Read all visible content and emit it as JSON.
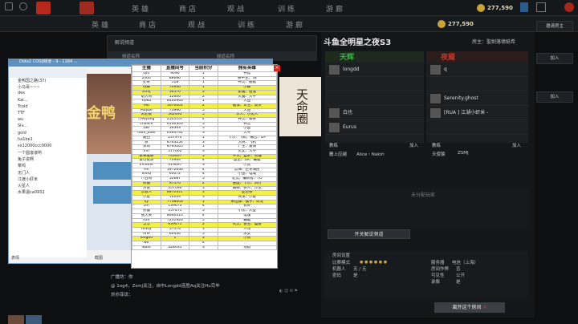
{
  "nav": {
    "items": [
      "英雄",
      "商店",
      "观战",
      "训练",
      "游廊"
    ]
  },
  "hud": {
    "gold": "277,590",
    "badge": "0"
  },
  "lobby": {
    "title": "解说频道",
    "col1": "频道名称",
    "col2": "频道名称"
  },
  "qq": {
    "title": "Dota2 COSIJ频道 - 9 - 1184 ...",
    "list": [
      "金鸭国之路(37)",
      "小马哥~~~",
      "dex",
      "Kai...",
      "Tcold",
      "TTF",
      "wu",
      "Slv...",
      "gold",
      "ha1be1",
      "sx12000ccc0000",
      "一个圆滚滚哟",
      "兔子说啊",
      "菜鸡",
      "无门人",
      "江渡小虾米",
      "火星人",
      "水果温ca0932"
    ],
    "chat_btns": [
      "表情",
      "截图",
      "发送"
    ]
  },
  "sheet": {
    "headers": [
      "主播",
      "直播间号",
      "当前积分",
      "拥有英雄"
    ],
    "rows": [
      [
        "zy0",
        "9090",
        "1",
        "神官"
      ],
      [
        "zhou",
        "88666",
        "1",
        "铁甲王、TB"
      ],
      [
        "老哥",
        "118",
        "1",
        "神灵、骷髅"
      ],
      [
        "谷辰",
        "74940",
        "1",
        "小娜"
      ],
      [
        "zsmj",
        "56570",
        "3",
        "影魔、石鬼"
      ],
      [
        "斩大哥",
        "12600",
        "2",
        "火猫、大牛"
      ],
      [
        "Haku",
        "8440963",
        "1",
        "大鱼"
      ],
      [
        "Mu",
        "1670001",
        "2",
        "敌法、斧王、双头"
      ],
      [
        "Maybe",
        "73966",
        "5",
        "大鱼"
      ],
      [
        "刘老板",
        "562493",
        "5",
        "水人、小黑人"
      ],
      [
        "小鸭yang",
        "2505147",
        "4",
        "神灵、钢背"
      ],
      [
        "chalice",
        "6130303",
        "5",
        "神灵"
      ],
      [
        "tab",
        "56363",
        "5",
        "小鱼"
      ],
      [
        "faith_bian",
        "6394791",
        "3",
        "大牛"
      ],
      [
        "路西",
        "237974",
        "1",
        "卡尔、飞机、痛苦、DP"
      ],
      [
        "依",
        "8763254",
        "3",
        "大树、飞机"
      ],
      [
        "深圳",
        "8763265",
        "1",
        "尸王、雷骑"
      ],
      [
        "lnh",
        "577002",
        "3",
        "火女、大牛"
      ],
      [
        "象咪猴聊",
        "743407",
        "5",
        "牛头、蓝胖、熊猫"
      ],
      [
        "爱玩夜游",
        "73964",
        "4",
        "虚空、DK、蝙蝠"
      ],
      [
        "inflame",
        "419697",
        "3",
        "小黑"
      ],
      [
        "Hh",
        "1972646",
        "4",
        "恐怖、巨牙海民"
      ],
      [
        "xiniQ",
        "63072",
        "4",
        "小鱼、电魂"
      ],
      [
        "八百哥",
        "52687",
        "5",
        "老虎、编织者、TD"
      ],
      [
        "熊猫",
        "97570",
        "2",
        "巫医、卡尔、风行"
      ],
      [
        "方便",
        "357096",
        "3",
        "蜘蛛、树人、沙王"
      ],
      [
        "华数人",
        "8870321",
        "3",
        "亚巴顿"
      ],
      [
        "小鱼",
        "72224",
        "3",
        "光法、小鹿"
      ],
      [
        "xy",
        "7738643",
        "1",
        "米拉娜、猴子、冰龙"
      ],
      [
        "zm",
        "139673",
        "4",
        "修补"
      ],
      [
        "熊猫",
        "557471",
        "5",
        "小黑、大圣"
      ],
      [
        "张大夫",
        "8660410",
        "4",
        "电魂"
      ],
      [
        "hzh",
        "7231926",
        "5",
        "蝙蝠"
      ],
      [
        "浮浮",
        "639471",
        "2",
        "死灵、兽王、瘟疫"
      ],
      [
        "mudy",
        "57174",
        "3",
        "人马"
      ],
      [
        "Ane",
        "60434",
        "5",
        "冰女"
      ],
      [
        "longdd",
        "1",
        "3",
        "小熊"
      ],
      [
        "wo",
        "",
        "4",
        ""
      ],
      [
        "waid",
        "328031",
        "3",
        "地狱"
      ]
    ]
  },
  "tianming": "天命圈",
  "chatlog": {
    "line1": "广播坊：你",
    "line2": "@ 1og4，Zsmj关注，自中Longdd连胜Aq关注Hu完毕",
    "line3": "刘亦菲说："
  },
  "room": {
    "title": "斗鱼全明星之夜S3",
    "owner_label": "房主：聖劍落德紙希",
    "radiant": "天辉",
    "dire": "夜魇",
    "radiant_players": [
      "longdd",
      "",
      "",
      "白也",
      "Eurus"
    ],
    "dire_players": [
      "q",
      "",
      "Serenity.ghost",
      "[RUA ] 江湖小虾米 -",
      ""
    ],
    "coach_label": "教练",
    "join": "加入",
    "radiant_coach": "麓上应越",
    "radiant_coach2": "Alice・Nakiri",
    "dire_coach": "天使猿",
    "dire_coach2": "ZSMJ",
    "unassigned": "未分配玩家",
    "open_commentary": "开关解说频道"
  },
  "settings": {
    "title": "房间设置",
    "left_labels": [
      "比赛模式",
      "机器人",
      "密码",
      "服务器",
      "房间作弊",
      "可见性",
      "录像"
    ],
    "mode": "",
    "bots": "无 / 无",
    "password": "是",
    "server": "电信（上海）",
    "cheats": "否",
    "visibility": "公开",
    "replay": "是",
    "leave": "离开这个房间"
  },
  "side": {
    "btn1": "邀请房主",
    "btn2": "加入",
    "btn3": "加入"
  },
  "colors": {
    "radiant": "#3fae49",
    "dire": "#c1362a"
  }
}
